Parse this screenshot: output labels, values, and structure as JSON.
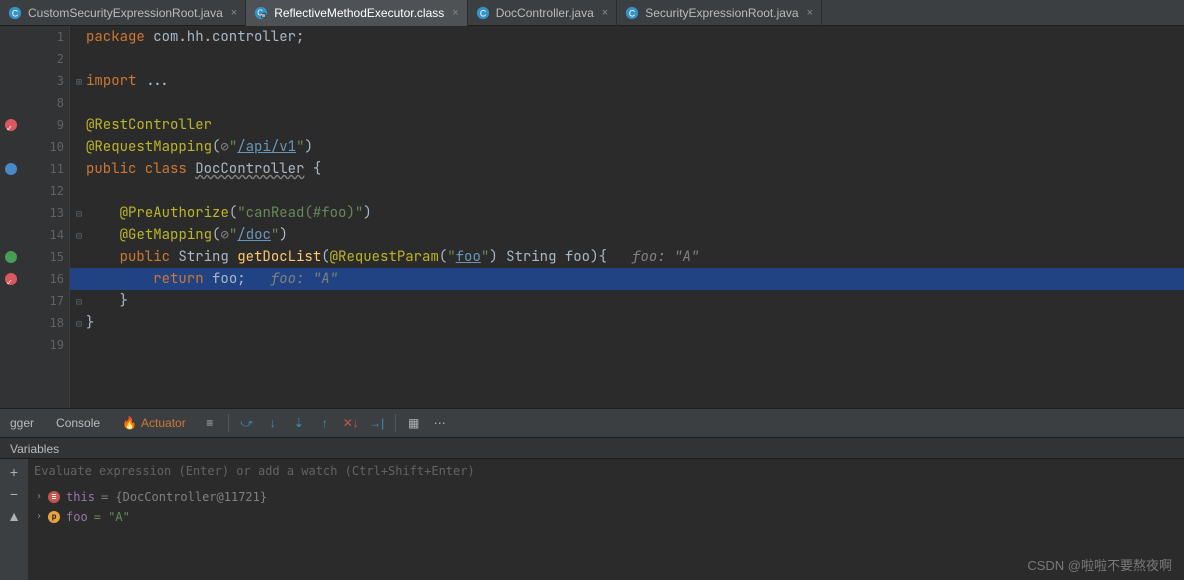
{
  "tabs": [
    {
      "name": "CustomSecurityExpressionRoot.java",
      "kind": "java",
      "active": false
    },
    {
      "name": "ReflectiveMethodExecutor.class",
      "kind": "class",
      "active": true
    },
    {
      "name": "DocController.java",
      "kind": "java",
      "active": false
    },
    {
      "name": "SecurityExpressionRoot.java",
      "kind": "java",
      "active": false
    }
  ],
  "lines": [
    {
      "n": "1",
      "code": [
        {
          "t": "package ",
          "c": "kw"
        },
        {
          "t": "com.hh.controller",
          "c": "cls"
        },
        {
          "t": ";",
          "c": "cls"
        }
      ]
    },
    {
      "n": "2",
      "code": []
    },
    {
      "n": "3",
      "fold": "+",
      "code": [
        {
          "t": "import ",
          "c": "kw"
        },
        {
          "t": "...",
          "c": "cls"
        }
      ]
    },
    {
      "n": "8",
      "code": []
    },
    {
      "n": "9",
      "icon": "bp-ok",
      "code": [
        {
          "t": "@RestController",
          "c": "ann"
        }
      ]
    },
    {
      "n": "10",
      "code": [
        {
          "t": "@RequestMapping",
          "c": "ann"
        },
        {
          "t": "(",
          "c": "cls"
        },
        {
          "t": "⊘",
          "c": "obj"
        },
        {
          "t": "\"",
          "c": "str"
        },
        {
          "t": "/api/v1",
          "c": "link"
        },
        {
          "t": "\"",
          "c": "str"
        },
        {
          "t": ")",
          "c": "cls"
        }
      ]
    },
    {
      "n": "11",
      "icon": "nav",
      "code": [
        {
          "t": "public class ",
          "c": "kw"
        },
        {
          "t": "DocController",
          "c": "id-u"
        },
        {
          "t": " {",
          "c": "cls"
        }
      ]
    },
    {
      "n": "12",
      "code": []
    },
    {
      "n": "13",
      "fold": "-",
      "code": [
        {
          "t": "    ",
          "c": ""
        },
        {
          "t": "@PreAuthorize",
          "c": "ann"
        },
        {
          "t": "(",
          "c": "cls"
        },
        {
          "t": "\"",
          "c": "str"
        },
        {
          "t": "canRead(#foo)",
          "c": "str"
        },
        {
          "t": "\"",
          "c": "str"
        },
        {
          "t": ")",
          "c": "cls"
        }
      ]
    },
    {
      "n": "14",
      "fold": "-",
      "code": [
        {
          "t": "    ",
          "c": ""
        },
        {
          "t": "@GetMapping",
          "c": "ann"
        },
        {
          "t": "(",
          "c": "cls"
        },
        {
          "t": "⊘",
          "c": "obj"
        },
        {
          "t": "\"",
          "c": "str"
        },
        {
          "t": "/doc",
          "c": "link"
        },
        {
          "t": "\"",
          "c": "str"
        },
        {
          "t": ")",
          "c": "cls"
        }
      ]
    },
    {
      "n": "15",
      "icon": "nav2",
      "code": [
        {
          "t": "    ",
          "c": ""
        },
        {
          "t": "public ",
          "c": "kw"
        },
        {
          "t": "String ",
          "c": "cls"
        },
        {
          "t": "getDocList",
          "c": "mtd"
        },
        {
          "t": "(",
          "c": "cls"
        },
        {
          "t": "@RequestParam",
          "c": "ann"
        },
        {
          "t": "(",
          "c": "cls"
        },
        {
          "t": "\"",
          "c": "str"
        },
        {
          "t": "foo",
          "c": "link"
        },
        {
          "t": "\"",
          "c": "str"
        },
        {
          "t": ") String foo){   ",
          "c": "cls"
        },
        {
          "t": "foo: \"A\"",
          "c": "cmt"
        }
      ]
    },
    {
      "n": "16",
      "icon": "bp-hit",
      "hl": true,
      "code": [
        {
          "t": "        ",
          "c": ""
        },
        {
          "t": "return ",
          "c": "kw"
        },
        {
          "t": "foo",
          "c": "cls"
        },
        {
          "t": ";   ",
          "c": "cls"
        },
        {
          "t": "foo: \"A\"",
          "c": "cmt"
        }
      ]
    },
    {
      "n": "17",
      "fold": "-",
      "code": [
        {
          "t": "    }",
          "c": "cls"
        }
      ]
    },
    {
      "n": "18",
      "fold": "-",
      "code": [
        {
          "t": "}",
          "c": "cls"
        }
      ]
    },
    {
      "n": "19",
      "code": []
    }
  ],
  "debug": {
    "tabs": {
      "debugger": "gger",
      "console": "Console",
      "actuator": "Actuator"
    },
    "varsHeader": "Variables",
    "evalPlaceholder": "Evaluate expression (Enter) or add a watch (Ctrl+Shift+Enter)",
    "vars": [
      {
        "icon": "lines",
        "name": "this",
        "val": "= {DocController@11721}",
        "nameColor": "#9876aa"
      },
      {
        "icon": "p",
        "name": "foo",
        "val": "= \"A\"",
        "nameColor": "#9876aa",
        "valColor": "#6a8759"
      }
    ]
  },
  "watermark": "CSDN @啦啦不要熬夜啊"
}
